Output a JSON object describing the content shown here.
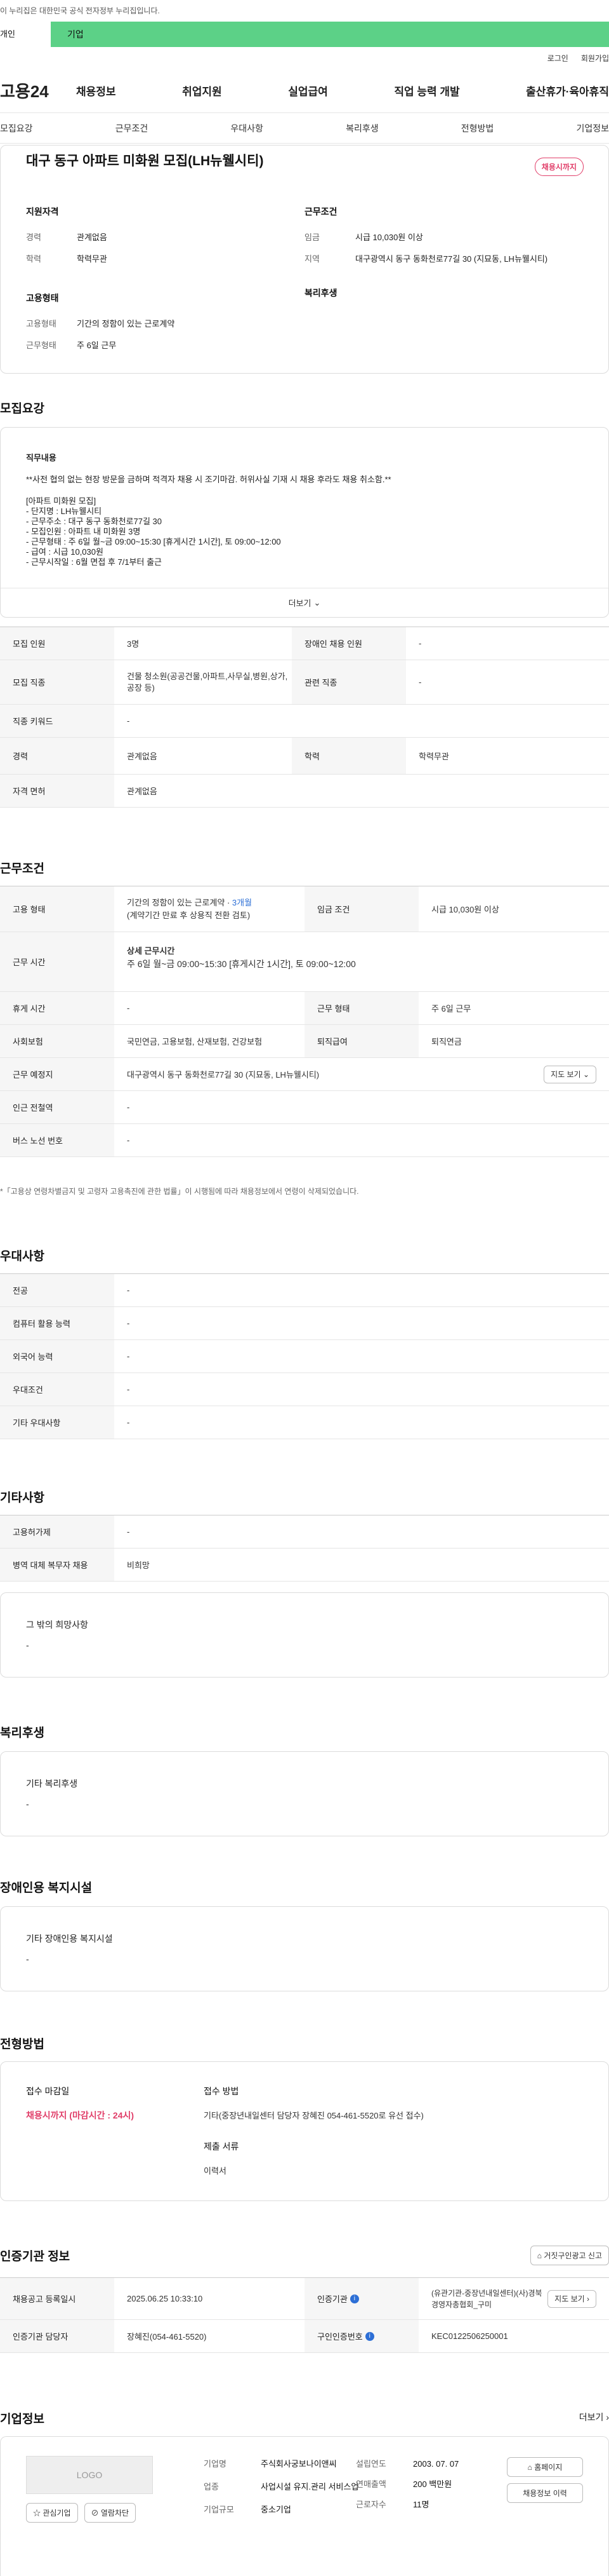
{
  "gov_banner": "이 누리집은 대한민국 공식 전자정부 누리집입니다.",
  "topbar": {
    "personal": "개인",
    "company": "기업"
  },
  "util": {
    "login": "로그인",
    "signup": "회원가입"
  },
  "gnb": {
    "logo": "고용24",
    "menu": [
      "채용정보",
      "취업지원",
      "실업급여",
      "직업 능력 개발",
      "출산휴가·육아휴직"
    ]
  },
  "tabs": [
    "모집요강",
    "근무조건",
    "우대사항",
    "복리후생",
    "전형방법",
    "기업정보"
  ],
  "summary": {
    "title": "대구 동구 아파트 미화원 모집(LH뉴웰시티)",
    "badge": "채용시까지",
    "qual": {
      "heading": "지원자격",
      "exp_k": "경력",
      "exp_v": "관계없음",
      "edu_k": "학력",
      "edu_v": "학력무관"
    },
    "emp": {
      "heading": "고용형태",
      "type_k": "고용형태",
      "type_v": "기간의 정함이 있는 근로계약",
      "form_k": "근무형태",
      "form_v": "주 6일 근무"
    },
    "cond": {
      "heading": "근무조건",
      "wage_k": "임금",
      "wage_v": "시급 10,030원 이상",
      "region_k": "지역",
      "region_v": "대구광역시 동구 동화천로77길 30 (지묘동, LH뉴웰시티)"
    },
    "welfare_heading": "복리후생"
  },
  "recruit": {
    "heading": "모집요강",
    "desc_label": "직무내용",
    "notice": "**사전 협의 없는 현장 방문을 금하며 적격자 채용 시 조기마감. 허위사실 기재 시 채용 후라도 채용 취소함.**",
    "lines": [
      "[아파트 미화원 모집]",
      "- 단지명 : LH뉴웰시티",
      "- 근무주소 : 대구 동구 동화천로77길 30",
      "- 모집인원 : 아파트 내 미화원 3명",
      "- 근무형태 : 주 6일 월~금 09:00~15:30 [휴게시간 1시간], 토 09:00~12:00",
      "- 급여 : 시급 10,030원",
      "- 근무시작일 : 6월 면접 후 7/1부터 출근"
    ],
    "more": "더보기"
  },
  "rt": {
    "r0": {
      "k1": "모집 인원",
      "v1": "3명",
      "k2": "장애인 채용 인원",
      "v2": "-"
    },
    "r1": {
      "k1": "모집 직종",
      "v1": "건물 청소원(공공건물,아파트,사무실,병원,상가,공장 등)",
      "k2": "관련 직종",
      "v2": "-"
    },
    "r2": {
      "k1": "직종 키워드",
      "v1": "-"
    },
    "r3": {
      "k1": "경력",
      "v1": "관계없음",
      "k2": "학력",
      "v2": "학력무관"
    },
    "r4": {
      "k1": "자격 면허",
      "v1": "관계없음"
    }
  },
  "cond": {
    "heading": "근무조건"
  },
  "ct": {
    "r0": {
      "k1": "고용 형태",
      "v1": "기간의 정함이 있는 근로계약 · ",
      "v1b": "3개월",
      "v1c": "(계약기간 만료 후 상용직 전환 검토)",
      "k2": "임금 조건",
      "v2": "시급 10,030원 이상"
    },
    "r1": {
      "k1": "근무 시간",
      "v1a": "상세 근무시간",
      "v1b": "주 6일 월~금 09:00~15:30 [휴게시간 1시간], 토 09:00~12:00"
    },
    "r2": {
      "k1": "휴게 시간",
      "v1": "-",
      "k2": "근무 형태",
      "v2": "주 6일 근무"
    },
    "r3": {
      "k1": "사회보험",
      "v1": "국민연금, 고용보험, 산재보험, 건강보험",
      "k2": "퇴직급여",
      "v2": "퇴직연금"
    },
    "r4": {
      "k1": "근무 예정지",
      "v1": "대구광역시 동구 동화천로77길 30 (지묘동, LH뉴웰시티)"
    },
    "map_btn": "지도 보기",
    "r5": {
      "k1": "인근 전철역",
      "v1": "-"
    },
    "r6": {
      "k1": "버스 노선 번호",
      "v1": "-"
    },
    "note": "*「고용상 연령차별금지 및 고령자 고용촉진에 관한 법률」이 시행됨에 따라 채용정보에서 연령이 삭제되었습니다."
  },
  "pref": {
    "heading": "우대사항",
    "rows": [
      {
        "k": "전공",
        "v": "-"
      },
      {
        "k": "컴퓨터 활용 능력",
        "v": "-"
      },
      {
        "k": "외국어 능력",
        "v": "-"
      },
      {
        "k": "우대조건",
        "v": "-"
      },
      {
        "k": "기타 우대사항",
        "v": "-"
      }
    ]
  },
  "etc": {
    "heading": "기타사항",
    "rows": [
      {
        "k": "고용허가제",
        "v": "-"
      },
      {
        "k": "병역 대체 복무자 채용",
        "v": "비희망"
      }
    ],
    "wish_label": "그 밖의 희망사항",
    "wish_value": "-"
  },
  "welfare": {
    "heading": "복리후생",
    "label": "기타 복리후생",
    "value": "-"
  },
  "disabled": {
    "heading": "장애인용 복지시설",
    "label": "기타 장애인용 복지시설",
    "value": "-"
  },
  "sel": {
    "heading": "전형방법",
    "deadline_k": "접수 마감일",
    "deadline_v": "채용시까지 (마감시간 : 24시)",
    "method_k": "접수 방법",
    "method_v": "기타(중장년내일센터 담당자 장혜진 054-461-5520로 유선 접수)",
    "docs_k": "제출 서류",
    "docs_v": "이력서"
  },
  "cert": {
    "heading": "인증기관 정보",
    "report_btn": "거짓구인광고 신고",
    "r0": {
      "k1": "채용공고 등록일시",
      "v1": "2025.06.25 10:33:10",
      "k2": "인증기관",
      "v2": "(유관기관-중장년내일센터)(사)경북경영자총협회_구미"
    },
    "map_btn": "지도 보기",
    "r1": {
      "k1": "인증기관 담당자",
      "v1": "장혜진(054-461-5520)",
      "k2": "구인인증번호",
      "v2": "KEC0122506250001"
    }
  },
  "company": {
    "heading": "기업정보",
    "more": "더보기",
    "logo": "LOGO",
    "fav_btn": "관심기업",
    "block_btn": "열람차단",
    "name_k": "기업명",
    "name_v": "주식회사궁보나이앤씨",
    "industry_k": "업종",
    "industry_v": "사업시설 유지.관리 서비스업",
    "size_k": "기업규모",
    "size_v": "중소기업",
    "founded_k": "설립연도",
    "founded_v": "2003. 07. 07",
    "sales_k": "연매출액",
    "sales_v": "200 백만원",
    "emp_k": "근로자수",
    "emp_v": "11명",
    "home_btn": "홈페이지",
    "recruit_btn": "채용정보 이력"
  }
}
